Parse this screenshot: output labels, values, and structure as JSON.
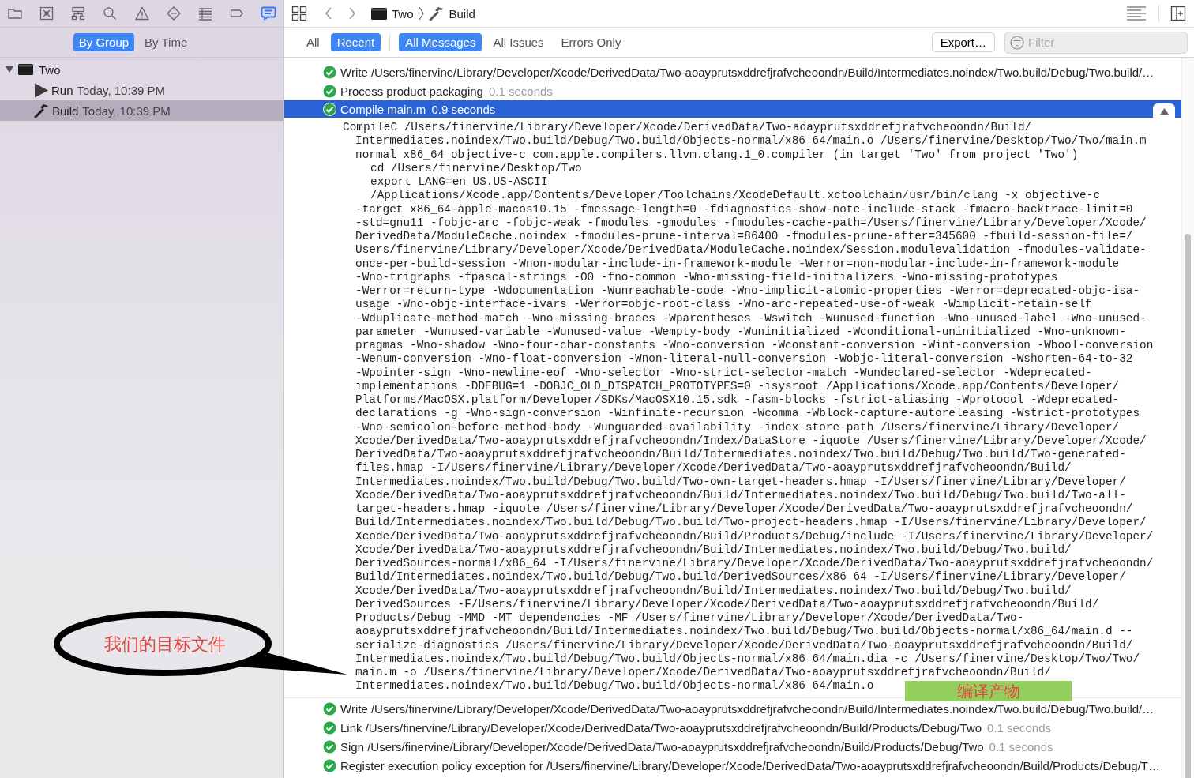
{
  "navigator": {
    "tabs": [
      {
        "kind": "folder",
        "selected": false
      },
      {
        "kind": "square-x",
        "selected": false
      },
      {
        "kind": "hierarchy",
        "selected": false
      },
      {
        "kind": "search",
        "selected": false
      },
      {
        "kind": "warning",
        "selected": false
      },
      {
        "kind": "diamond",
        "selected": false
      },
      {
        "kind": "list",
        "selected": false
      },
      {
        "kind": "tag",
        "selected": false
      },
      {
        "kind": "speech-bubble",
        "selected": true
      }
    ]
  },
  "sidebar": {
    "grouping": [
      {
        "label": "By Group",
        "selected": true
      },
      {
        "label": "By Time",
        "selected": false
      }
    ],
    "tree": [
      {
        "kind": "project",
        "label": "Two",
        "expanded": true,
        "children": [
          {
            "kind": "run",
            "label": "Run",
            "time": "Today, 10:39 PM",
            "selected": false
          },
          {
            "kind": "build",
            "label": "Build",
            "time": "Today, 10:39 PM",
            "selected": true
          }
        ]
      }
    ]
  },
  "toolbar": {
    "breadcrumb": [
      {
        "kind": "project",
        "label": "Two"
      },
      {
        "kind": "build",
        "label": "Build"
      }
    ]
  },
  "filter_bar": {
    "scopes": [
      {
        "label": "All",
        "selected": false
      },
      {
        "label": "Recent",
        "selected": true
      }
    ],
    "message_types": [
      {
        "label": "All Messages",
        "selected": true
      },
      {
        "label": "All Issues",
        "selected": false
      },
      {
        "label": "Errors Only",
        "selected": false
      }
    ],
    "export_button": "Export…",
    "filter": {
      "placeholder": "Filter"
    }
  },
  "log": {
    "entries": [
      {
        "succeeded": true,
        "text": "Write /Users/finervine/Library/Developer/Xcode/DerivedData/Two-aoayprutsxddrefjrafvcheoondn/Build/Intermediates.noindex/Two.build/Debug/Two.build/…",
        "selected": false,
        "expanded": false
      },
      {
        "succeeded": true,
        "text": "Process product packaging",
        "duration": "0.1 seconds",
        "selected": false,
        "expanded": false
      },
      {
        "succeeded": true,
        "text": "Compile main.m",
        "duration": "0.9 seconds",
        "selected": true,
        "expanded": true,
        "details": [
          {
            "kind": "command",
            "text": "CompileC /Users/finervine/Library/Developer/Xcode/DerivedData/Two-aoayprutsxddrefjrafvcheoondn/Build/"
          },
          {
            "kind": "wrapped",
            "text": "Intermediates.noindex/Two.build/Debug/Two.build/Objects-normal/x86_64/main.o /Users/finervine/Desktop/Two/Two/main.m"
          },
          {
            "kind": "wrapped",
            "text": "normal x86_64 objective-c com.apple.compilers.llvm.clang.1_0.compiler (in target 'Two' from project 'Two')"
          },
          {
            "kind": "shell",
            "text": "cd /Users/finervine/Desktop/Two"
          },
          {
            "kind": "shell",
            "text": "export LANG=en_US.US-ASCII"
          },
          {
            "kind": "shell",
            "text": "/Applications/Xcode.app/Contents/Developer/Toolchains/XcodeDefault.xctoolchain/usr/bin/clang -x objective-c"
          },
          {
            "kind": "wrapped",
            "text": "-target x86_64-apple-macos10.15 -fmessage-length=0 -fdiagnostics-show-note-include-stack -fmacro-backtrace-limit=0"
          },
          {
            "kind": "wrapped",
            "text": "-std=gnu11 -fobjc-arc -fobjc-weak -fmodules -gmodules -fmodules-cache-path=/Users/finervine/Library/Developer/Xcode/"
          },
          {
            "kind": "wrapped",
            "text": "DerivedData/ModuleCache.noindex -fmodules-prune-interval=86400 -fmodules-prune-after=345600 -fbuild-session-file=/"
          },
          {
            "kind": "wrapped",
            "text": "Users/finervine/Library/Developer/Xcode/DerivedData/ModuleCache.noindex/Session.modulevalidation -fmodules-validate-"
          },
          {
            "kind": "wrapped",
            "text": "once-per-build-session -Wnon-modular-include-in-framework-module -Werror=non-modular-include-in-framework-module"
          },
          {
            "kind": "wrapped",
            "text": "-Wno-trigraphs -fpascal-strings -O0 -fno-common -Wno-missing-field-initializers -Wno-missing-prototypes"
          },
          {
            "kind": "wrapped",
            "text": "-Werror=return-type -Wdocumentation -Wunreachable-code -Wno-implicit-atomic-properties -Werror=deprecated-objc-isa-"
          },
          {
            "kind": "wrapped",
            "text": "usage -Wno-objc-interface-ivars -Werror=objc-root-class -Wno-arc-repeated-use-of-weak -Wimplicit-retain-self"
          },
          {
            "kind": "wrapped",
            "text": "-Wduplicate-method-match -Wno-missing-braces -Wparentheses -Wswitch -Wunused-function -Wno-unused-label -Wno-unused-"
          },
          {
            "kind": "wrapped",
            "text": "parameter -Wunused-variable -Wunused-value -Wempty-body -Wuninitialized -Wconditional-uninitialized -Wno-unknown-"
          },
          {
            "kind": "wrapped",
            "text": "pragmas -Wno-shadow -Wno-four-char-constants -Wno-conversion -Wconstant-conversion -Wint-conversion -Wbool-conversion"
          },
          {
            "kind": "wrapped",
            "text": "-Wenum-conversion -Wno-float-conversion -Wnon-literal-null-conversion -Wobjc-literal-conversion -Wshorten-64-to-32"
          },
          {
            "kind": "wrapped",
            "text": "-Wpointer-sign -Wno-newline-eof -Wno-selector -Wno-strict-selector-match -Wundeclared-selector -Wdeprecated-"
          },
          {
            "kind": "wrapped",
            "text": "implementations -DDEBUG=1 -DOBJC_OLD_DISPATCH_PROTOTYPES=0 -isysroot /Applications/Xcode.app/Contents/Developer/"
          },
          {
            "kind": "wrapped",
            "text": "Platforms/MacOSX.platform/Developer/SDKs/MacOSX10.15.sdk -fasm-blocks -fstrict-aliasing -Wprotocol -Wdeprecated-"
          },
          {
            "kind": "wrapped",
            "text": "declarations -g -Wno-sign-conversion -Winfinite-recursion -Wcomma -Wblock-capture-autoreleasing -Wstrict-prototypes"
          },
          {
            "kind": "wrapped",
            "text": "-Wno-semicolon-before-method-body -Wunguarded-availability -index-store-path /Users/finervine/Library/Developer/"
          },
          {
            "kind": "wrapped",
            "text": "Xcode/DerivedData/Two-aoayprutsxddrefjrafvcheoondn/Index/DataStore -iquote /Users/finervine/Library/Developer/Xcode/"
          },
          {
            "kind": "wrapped",
            "text": "DerivedData/Two-aoayprutsxddrefjrafvcheoondn/Build/Intermediates.noindex/Two.build/Debug/Two.build/Two-generated-"
          },
          {
            "kind": "wrapped",
            "text": "files.hmap -I/Users/finervine/Library/Developer/Xcode/DerivedData/Two-aoayprutsxddrefjrafvcheoondn/Build/"
          },
          {
            "kind": "wrapped",
            "text": "Intermediates.noindex/Two.build/Debug/Two.build/Two-own-target-headers.hmap -I/Users/finervine/Library/Developer/"
          },
          {
            "kind": "wrapped",
            "text": "Xcode/DerivedData/Two-aoayprutsxddrefjrafvcheoondn/Build/Intermediates.noindex/Two.build/Debug/Two.build/Two-all-"
          },
          {
            "kind": "wrapped",
            "text": "target-headers.hmap -iquote /Users/finervine/Library/Developer/Xcode/DerivedData/Two-aoayprutsxddrefjrafvcheoondn/"
          },
          {
            "kind": "wrapped",
            "text": "Build/Intermediates.noindex/Two.build/Debug/Two.build/Two-project-headers.hmap -I/Users/finervine/Library/Developer/"
          },
          {
            "kind": "wrapped",
            "text": "Xcode/DerivedData/Two-aoayprutsxddrefjrafvcheoondn/Build/Products/Debug/include -I/Users/finervine/Library/Developer/"
          },
          {
            "kind": "wrapped",
            "text": "Xcode/DerivedData/Two-aoayprutsxddrefjrafvcheoondn/Build/Intermediates.noindex/Two.build/Debug/Two.build/"
          },
          {
            "kind": "wrapped",
            "text": "DerivedSources-normal/x86_64 -I/Users/finervine/Library/Developer/Xcode/DerivedData/Two-aoayprutsxddrefjrafvcheoondn/"
          },
          {
            "kind": "wrapped",
            "text": "Build/Intermediates.noindex/Two.build/Debug/Two.build/DerivedSources/x86_64 -I/Users/finervine/Library/Developer/"
          },
          {
            "kind": "wrapped",
            "text": "Xcode/DerivedData/Two-aoayprutsxddrefjrafvcheoondn/Build/Intermediates.noindex/Two.build/Debug/Two.build/"
          },
          {
            "kind": "wrapped",
            "text": "DerivedSources -F/Users/finervine/Library/Developer/Xcode/DerivedData/Two-aoayprutsxddrefjrafvcheoondn/Build/"
          },
          {
            "kind": "wrapped",
            "text": "Products/Debug -MMD -MT dependencies -MF /Users/finervine/Library/Developer/Xcode/DerivedData/Two-"
          },
          {
            "kind": "wrapped",
            "text": "aoayprutsxddrefjrafvcheoondn/Build/Intermediates.noindex/Two.build/Debug/Two.build/Objects-normal/x86_64/main.d --"
          },
          {
            "kind": "wrapped",
            "text": "serialize-diagnostics /Users/finervine/Library/Developer/Xcode/DerivedData/Two-aoayprutsxddrefjrafvcheoondn/Build/"
          },
          {
            "kind": "wrapped",
            "text": "Intermediates.noindex/Two.build/Debug/Two.build/Objects-normal/x86_64/main.dia -c /Users/finervine/Desktop/Two/Two/"
          },
          {
            "kind": "wrapped",
            "text": "main.m -o /Users/finervine/Library/Developer/Xcode/DerivedData/Two-aoayprutsxddrefjrafvcheoondn/Build/"
          },
          {
            "kind": "wrapped",
            "text": "Intermediates.noindex/Two.build/Debug/Two.build/Objects-normal/x86_64/main.o"
          }
        ]
      },
      {
        "succeeded": true,
        "text": "Write /Users/finervine/Library/Developer/Xcode/DerivedData/Two-aoayprutsxddrefjrafvcheoondn/Build/Intermediates.noindex/Two.build/Debug/Two.build/…",
        "selected": false,
        "expanded": false
      },
      {
        "succeeded": true,
        "text": "Link /Users/finervine/Library/Developer/Xcode/DerivedData/Two-aoayprutsxddrefjrafvcheoondn/Build/Products/Debug/Two",
        "duration": "0.1 seconds",
        "selected": false,
        "expanded": false
      },
      {
        "succeeded": true,
        "text": "Sign /Users/finervine/Library/Developer/Xcode/DerivedData/Two-aoayprutsxddrefjrafvcheoondn/Build/Products/Debug/Two",
        "duration": "0.1 seconds",
        "selected": false,
        "expanded": false
      },
      {
        "succeeded": true,
        "text": "Register execution policy exception for /Users/finervine/Library/Developer/Xcode/DerivedData/Two-aoayprutsxddrefjrafvcheoondn/Build/Products/Debug/T…",
        "selected": false,
        "expanded": false
      }
    ]
  },
  "annotations": [
    {
      "kind": "callout",
      "text": "我们的目标文件"
    },
    {
      "kind": "label",
      "text": "编译产物"
    }
  ]
}
